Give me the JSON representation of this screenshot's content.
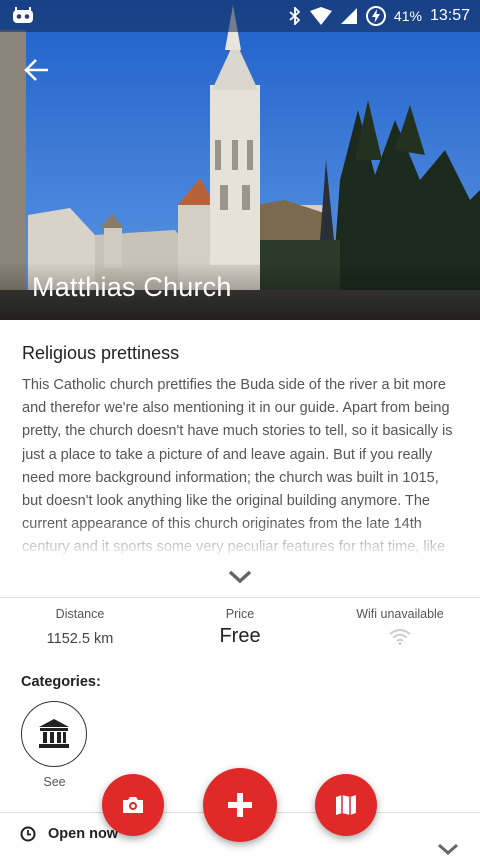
{
  "status_bar": {
    "battery": "41%",
    "time": "13:57",
    "icons": [
      "app-notification-icon",
      "bluetooth-icon",
      "wifi-icon",
      "signal-icon",
      "battery-charging-icon"
    ]
  },
  "hero": {
    "title": "Matthias Church"
  },
  "detail": {
    "heading": "Religious prettiness",
    "description": "This Catholic church prettifies the Buda side of the river a bit more and therefor we're also mentioning it in our guide. Apart from being pretty, the church doesn't have much stories to tell, so it basically is just a place to take a picture of and leave again. But if you really need more background information; the church was built in 1015, but doesn't look anything like the original building anymore. The current appearance of this church originates from the late 14th century and it sports some very peculiar features for that time, like per example..."
  },
  "info": {
    "distance_label": "Distance",
    "distance_value": "1152.5 km",
    "price_label": "Price",
    "price_value": "Free",
    "wifi_label": "Wifi unavailable"
  },
  "categories": {
    "label": "Categories:",
    "items": [
      {
        "name": "See",
        "icon": "museum-icon"
      }
    ]
  },
  "hours": {
    "label": "Open now"
  },
  "fabs": [
    "camera-icon",
    "plus-icon",
    "map-icon"
  ],
  "colors": {
    "accent": "#e02a2a",
    "sky": "#2f6fd1"
  }
}
